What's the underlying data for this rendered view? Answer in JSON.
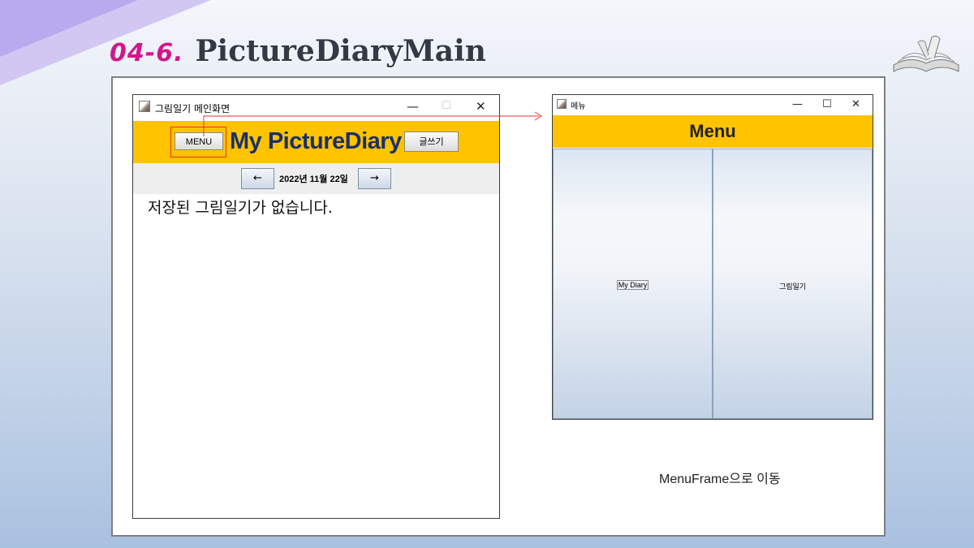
{
  "slide": {
    "number": "04-6.",
    "title": "PictureDiaryMain",
    "caption": "MenuFrame으로 이동"
  },
  "main_window": {
    "title": "그림일기 메인화면",
    "menu_button": "MENU",
    "heading": "My PictureDiary",
    "write_button": "글쓰기",
    "prev_button": "←",
    "next_button": "→",
    "date": "2022년 11월 22일",
    "empty_message": "저장된 그림일기가 없습니다."
  },
  "menu_window": {
    "title": "메뉴",
    "header": "Menu",
    "left_item": "My Diary",
    "right_item": "그림일기"
  },
  "window_controls": {
    "minimize": "—",
    "maximize": "☐",
    "close": "✕"
  },
  "colors": {
    "accent_orange": "#ffc300",
    "highlight_red": "#e53030",
    "slide_number_pink": "#d2168c"
  }
}
